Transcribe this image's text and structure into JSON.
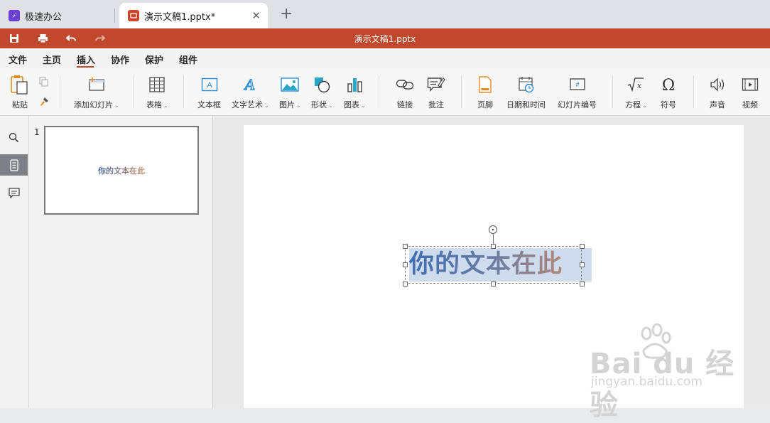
{
  "browser": {
    "tabs": [
      {
        "title": "极速办公"
      },
      {
        "title": "演示文稿1.pptx*"
      }
    ],
    "new_tab_label": "+"
  },
  "titlebar": {
    "document_title": "演示文稿1.pptx"
  },
  "menu": {
    "tabs": [
      "文件",
      "主页",
      "插入",
      "协作",
      "保护",
      "组件"
    ],
    "active_tab": "插入"
  },
  "ribbon": {
    "paste": "粘贴",
    "add_slide": "添加幻灯片",
    "table": "表格",
    "textbox": "文本框",
    "text_art": "文字艺术",
    "image": "图片",
    "shape": "形状",
    "chart": "图表",
    "link": "链接",
    "comment": "批注",
    "header_footer": "页脚",
    "date_time": "日期和时间",
    "slide_number": "幻灯片编号",
    "equation": "方程",
    "symbol": "符号",
    "audio": "声音",
    "video": "视频"
  },
  "slides": {
    "thumb_number": "1",
    "thumb_text": "你的文本在此"
  },
  "slide": {
    "text": "你的文本在此"
  },
  "watermark": {
    "brand": "Bai du 经验",
    "url": "jingyan.baidu.com"
  },
  "colors": {
    "accent": "#c0492d",
    "title_bar": "#c0492d"
  }
}
